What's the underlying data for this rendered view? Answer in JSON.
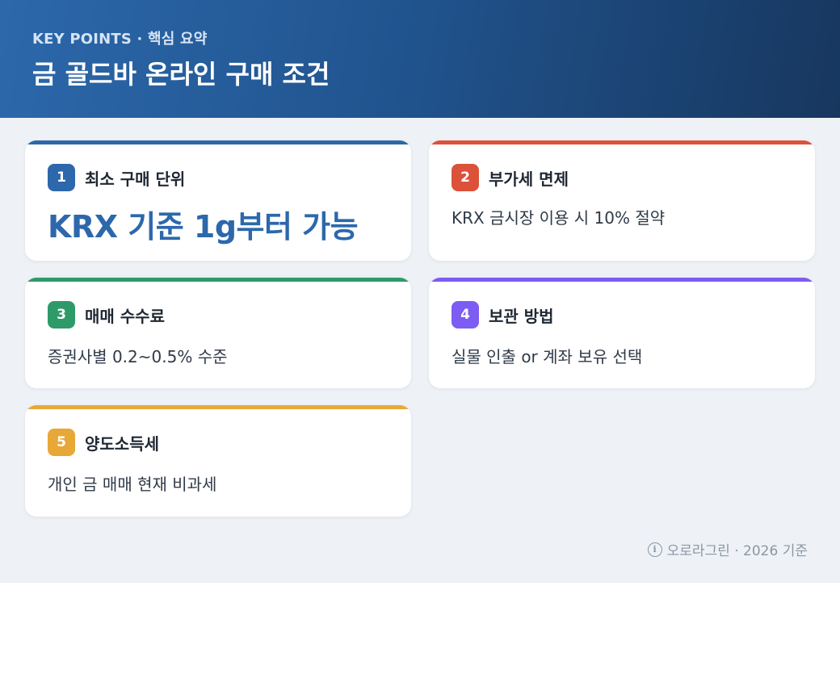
{
  "header": {
    "eyebrow": "KEY POINTS · 핵심 요약",
    "title": "금 골드바 온라인 구매 조건"
  },
  "cards": [
    {
      "number": "1",
      "title": "최소 구매 단위",
      "highlight": "KRX 기준 1g부터 가능",
      "accent": "#2c68ab"
    },
    {
      "number": "2",
      "title": "부가세 면제",
      "desc": "KRX 금시장 이용 시 10% 절약",
      "accent": "#dc513a"
    },
    {
      "number": "3",
      "title": "매매 수수료",
      "desc": "증권사별 0.2~0.5% 수준",
      "accent": "#2e9a6a"
    },
    {
      "number": "4",
      "title": "보관 방법",
      "desc": "실물 인출 or 계좌 보유 선택",
      "accent": "#7c5cf2"
    },
    {
      "number": "5",
      "title": "양도소득세",
      "desc": "개인 금 매매 현재 비과세",
      "accent": "#e8a838"
    }
  ],
  "footer": {
    "icon": "info-icon",
    "text": "오로라그린 · 2026 기준"
  }
}
